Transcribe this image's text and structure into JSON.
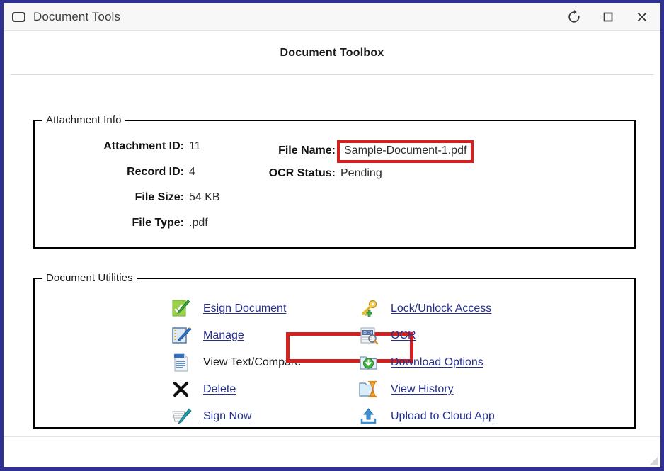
{
  "window": {
    "title": "Document Tools",
    "icon": "window-icon",
    "controls": [
      {
        "name": "refresh-button",
        "icon": "refresh-icon",
        "label": "Refresh"
      },
      {
        "name": "maximize-button",
        "icon": "maximize-icon",
        "label": "Maximize"
      },
      {
        "name": "close-button",
        "icon": "close-icon",
        "label": "Close"
      }
    ],
    "border_color": "#2e3192",
    "titlebar_color": "#f7f7f7"
  },
  "page": {
    "heading": "Document Toolbox"
  },
  "attachment_info": {
    "legend": "Attachment Info",
    "left_fields": [
      {
        "label": "Attachment ID:",
        "value": "11"
      },
      {
        "label": "Record ID:",
        "value": "4"
      },
      {
        "label": "File Size:",
        "value": "54 KB"
      },
      {
        "label": "File Type:",
        "value": ".pdf"
      }
    ],
    "right_fields": [
      {
        "label": "File Name:",
        "value": "Sample-Document-1.pdf",
        "highlighted": true
      },
      {
        "label": "OCR Status:",
        "value": "Pending",
        "highlighted": false
      }
    ]
  },
  "document_utilities": {
    "legend": "Document Utilities",
    "left_items": [
      {
        "label": "Esign Document",
        "icon": "green-note-pencil-icon",
        "is_link": true,
        "highlighted": false
      },
      {
        "label": "Manage",
        "icon": "blue-note-pencil-icon",
        "is_link": true,
        "highlighted": true
      },
      {
        "label": "View Text/Compare",
        "icon": "text-document-icon",
        "is_link": false,
        "highlighted": false
      },
      {
        "label": "Delete",
        "icon": "black-x-icon",
        "is_link": true,
        "highlighted": false
      },
      {
        "label": "Sign Now",
        "icon": "signature-pen-icon",
        "is_link": true,
        "highlighted": false
      }
    ],
    "right_items": [
      {
        "label": "Lock/Unlock Access",
        "icon": "key-icon",
        "is_link": true,
        "highlighted": false
      },
      {
        "label": "OCR",
        "icon": "ocr-scan-icon",
        "is_link": true,
        "highlighted": false
      },
      {
        "label": "Download Options",
        "icon": "download-folder-icon",
        "is_link": true,
        "highlighted": false
      },
      {
        "label": "View History",
        "icon": "history-hourglass-icon",
        "is_link": true,
        "highlighted": false
      },
      {
        "label": "Upload to Cloud App",
        "icon": "upload-arrow-icon",
        "is_link": true,
        "highlighted": false
      }
    ]
  },
  "colors": {
    "annotation": "#d52020",
    "link": "#26308c",
    "window_border": "#2e3192"
  },
  "statusbar": {
    "resize_grip": "resize-grip-icon"
  }
}
